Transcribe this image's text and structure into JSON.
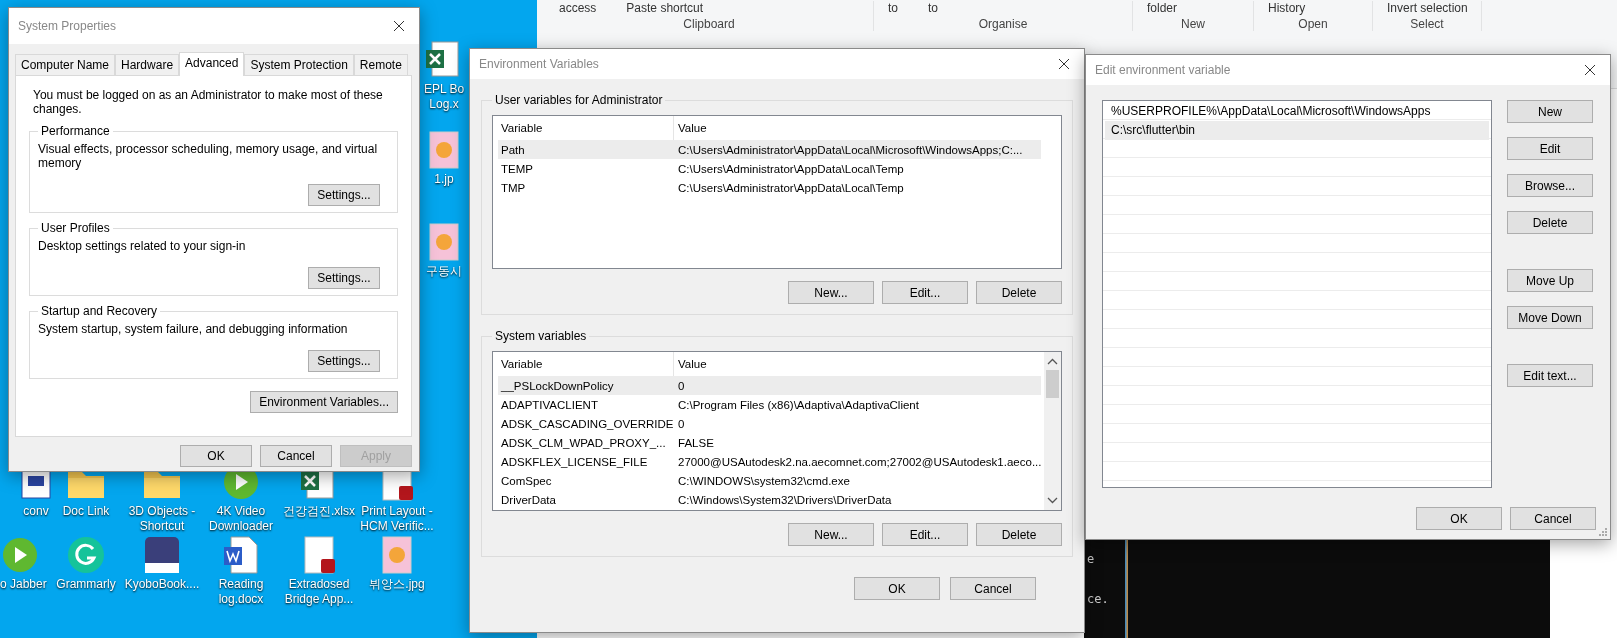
{
  "explorer_ribbon": {
    "groups": [
      {
        "label": "Clipboard",
        "items": [
          "access",
          "Paste shortcut"
        ]
      },
      {
        "label": "Organise",
        "items": [
          "to",
          "to"
        ]
      },
      {
        "label": "New",
        "items": [
          "folder"
        ]
      },
      {
        "label": "Open",
        "items": [
          "History"
        ]
      },
      {
        "label": "Select",
        "items": [
          "Invert selection"
        ]
      }
    ]
  },
  "terminal": {
    "lines": [
      "e",
      "ce."
    ]
  },
  "desktop_icons": [
    {
      "label": "EPL Bo\nLog.x",
      "kind": "excel"
    },
    {
      "label": "1.jp",
      "kind": "image"
    },
    {
      "label": "구동시",
      "kind": "image"
    },
    {
      "label": "conv",
      "kind": "doc"
    },
    {
      "label": "Doc Link",
      "kind": "folder"
    },
    {
      "label": "3D Objects -\nShortcut",
      "kind": "folder"
    },
    {
      "label": "4K Video\nDownloader",
      "kind": "app"
    },
    {
      "label": "건강검진.xlsx",
      "kind": "excel"
    },
    {
      "label": "Print Layout -\nHCM Verific...",
      "kind": "pdf"
    },
    {
      "label": "o Jabber",
      "kind": "app"
    },
    {
      "label": "Grammarly",
      "kind": "grammarly"
    },
    {
      "label": "KyoboBook....",
      "kind": "ebook"
    },
    {
      "label": "Reading\nlog.docx",
      "kind": "word"
    },
    {
      "label": "Extradosed\nBridge App...",
      "kind": "pdf"
    },
    {
      "label": "뷔앙스.jpg",
      "kind": "image"
    }
  ],
  "system_properties": {
    "title": "System Properties",
    "tabs": [
      {
        "label": "Computer Name",
        "selected": false
      },
      {
        "label": "Hardware",
        "selected": false
      },
      {
        "label": "Advanced",
        "selected": true
      },
      {
        "label": "System Protection",
        "selected": false
      },
      {
        "label": "Remote",
        "selected": false
      }
    ],
    "notice": "You must be logged on as an Administrator to make most of these changes.",
    "groups": [
      {
        "title": "Performance",
        "description": "Visual effects, processor scheduling, memory usage, and virtual memory",
        "button": "Settings..."
      },
      {
        "title": "User Profiles",
        "description": "Desktop settings related to your sign-in",
        "button": "Settings..."
      },
      {
        "title": "Startup and Recovery",
        "description": "System startup, system failure, and debugging information",
        "button": "Settings..."
      }
    ],
    "environment_button": "Environment Variables...",
    "buttons": [
      {
        "label": "OK",
        "disabled": false
      },
      {
        "label": "Cancel",
        "disabled": false
      },
      {
        "label": "Apply",
        "disabled": true
      }
    ]
  },
  "environment_variables": {
    "title": "Environment Variables",
    "sections": [
      {
        "title": "User variables for Administrator",
        "columns": [
          "Variable",
          "Value"
        ],
        "scrollbar": false,
        "rows": [
          {
            "variable": "Path",
            "value": "C:\\Users\\Administrator\\AppData\\Local\\Microsoft\\WindowsApps;C:...",
            "selected": true
          },
          {
            "variable": "TEMP",
            "value": "C:\\Users\\Administrator\\AppData\\Local\\Temp",
            "selected": false
          },
          {
            "variable": "TMP",
            "value": "C:\\Users\\Administrator\\AppData\\Local\\Temp",
            "selected": false
          }
        ],
        "buttons": [
          "New...",
          "Edit...",
          "Delete"
        ]
      },
      {
        "title": "System variables",
        "columns": [
          "Variable",
          "Value"
        ],
        "scrollbar": true,
        "rows": [
          {
            "variable": "__PSLockDownPolicy",
            "value": "0",
            "selected": true
          },
          {
            "variable": "ADAPTIVACLIENT",
            "value": "C:\\Program Files (x86)\\Adaptiva\\AdaptivaClient",
            "selected": false
          },
          {
            "variable": "ADSK_CASCADING_OVERRIDE",
            "value": "0",
            "selected": false
          },
          {
            "variable": "ADSK_CLM_WPAD_PROXY_...",
            "value": "FALSE",
            "selected": false
          },
          {
            "variable": "ADSKFLEX_LICENSE_FILE",
            "value": "27000@USAutodesk2.na.aecomnet.com;27002@USAutodesk1.aeco...",
            "selected": false
          },
          {
            "variable": "ComSpec",
            "value": "C:\\WINDOWS\\system32\\cmd.exe",
            "selected": false
          },
          {
            "variable": "DriverData",
            "value": "C:\\Windows\\System32\\Drivers\\DriverData",
            "selected": false
          }
        ],
        "buttons": [
          "New...",
          "Edit...",
          "Delete"
        ]
      }
    ],
    "buttons": [
      "OK",
      "Cancel"
    ]
  },
  "edit_environment_variable": {
    "title": "Edit environment variable",
    "entries": [
      {
        "text": "%USERPROFILE%\\AppData\\Local\\Microsoft\\WindowsApps",
        "selected": false
      },
      {
        "text": "C:\\src\\flutter\\bin",
        "selected": true
      }
    ],
    "side_button_groups": [
      [
        "New",
        "Edit",
        "Browse...",
        "Delete"
      ],
      [
        "Move Up",
        "Move Down"
      ],
      [
        "Edit text..."
      ]
    ],
    "buttons": [
      "OK",
      "Cancel"
    ]
  }
}
